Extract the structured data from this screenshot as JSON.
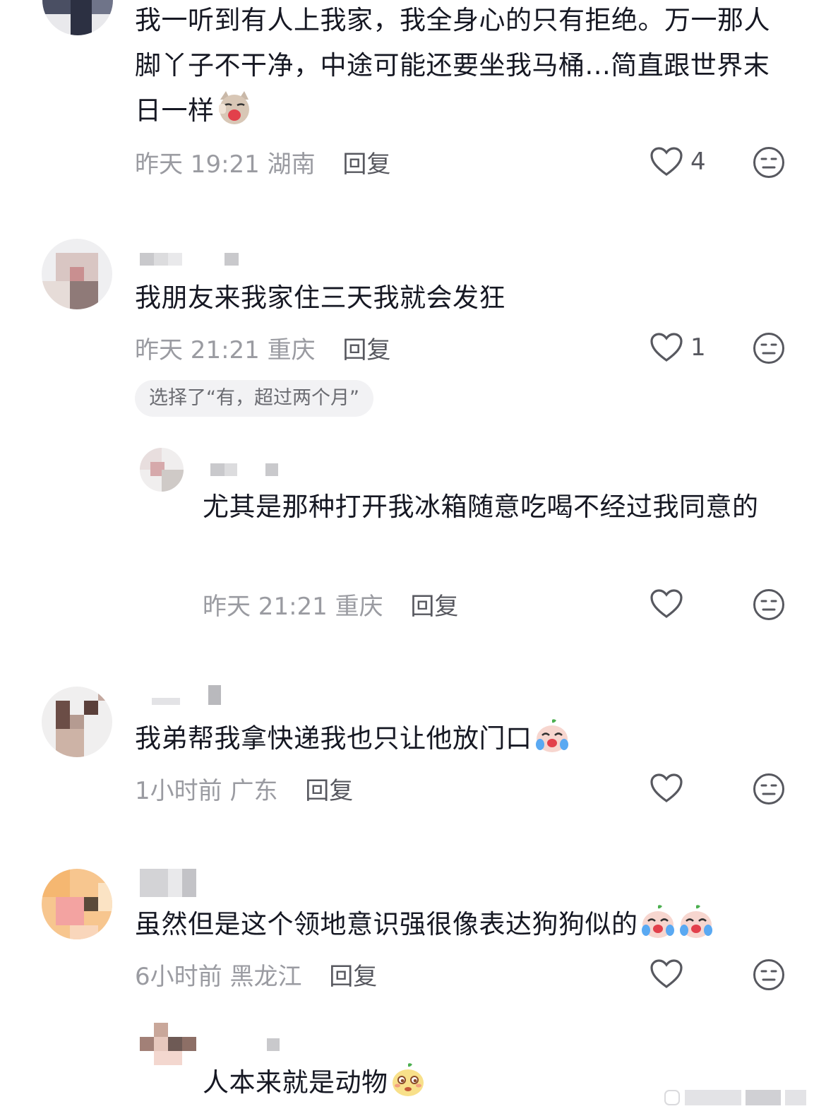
{
  "comments": [
    {
      "text": "我一听到有人上我家，我全身心的只有拒绝。万一那人脚丫子不干净，中途可能还要坐我马桶...简直跟世界末日一样",
      "emoji": "cat-yawning-emoji",
      "time": "昨天 19:21",
      "location": "湖南",
      "reply_label": "回复",
      "likes": "4"
    },
    {
      "text": "我朋友来我家住三天我就会发狂",
      "time": "昨天 21:21",
      "location": "重庆",
      "reply_label": "回复",
      "likes": "1",
      "poll_tag": "选择了“有，超过两个月”"
    },
    {
      "text": "尤其是那种打开我冰箱随意吃喝不经过我同意的",
      "time": "昨天 21:21",
      "location": "重庆",
      "reply_label": "回复",
      "likes": ""
    },
    {
      "text": "我弟帮我拿快递我也只让他放门口",
      "emoji": "crying-face-emoji",
      "time": "1小时前",
      "location": "广东",
      "reply_label": "回复",
      "likes": ""
    },
    {
      "text": "虽然但是这个领地意识强很像表达狗狗似的",
      "emoji": "crying-face-emoji",
      "time": "6小时前",
      "location": "黑龙江",
      "reply_label": "回复",
      "likes": ""
    },
    {
      "text": "人本来就是动物",
      "emoji": "smug-face-emoji"
    }
  ],
  "icons": {
    "like": "heart-outline-icon",
    "reaction": "neutral-face-icon"
  },
  "colors": {
    "text": "#161823",
    "meta": "#9a9ba1",
    "reply": "#57585f",
    "tag_bg": "#f2f2f4"
  }
}
